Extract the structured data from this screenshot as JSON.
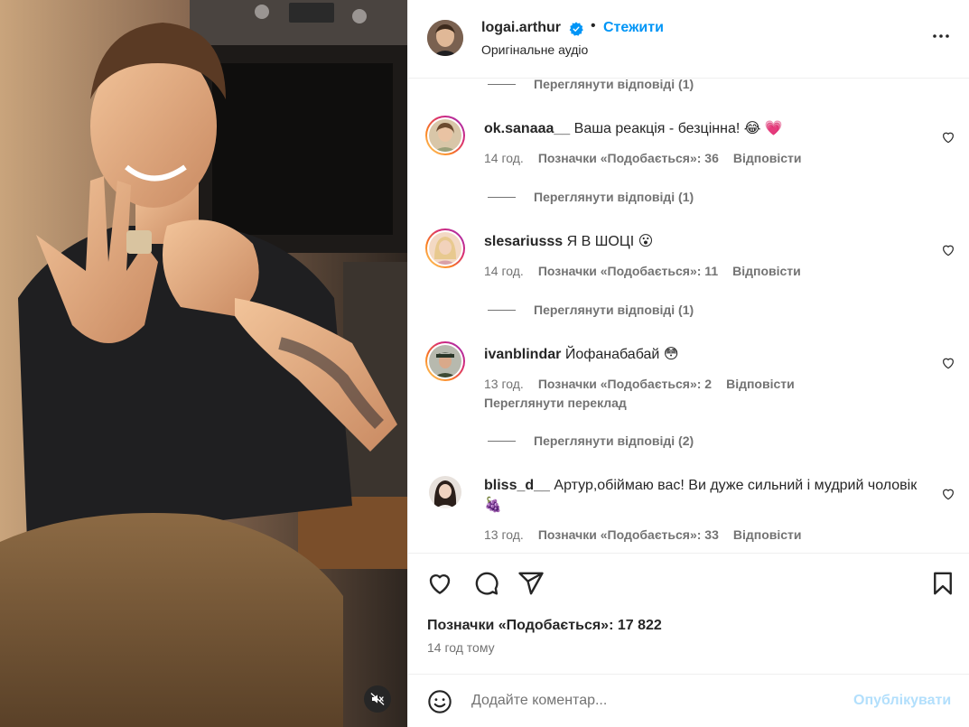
{
  "post": {
    "author": "logai.arthur",
    "follow_label": "Стежити",
    "separator": "•",
    "audio": "Оригінальне аудіо",
    "likes": "Позначки «Подобається»: 17 822",
    "time_ago": "14 год тому"
  },
  "comments": [
    {
      "top_replies": "Переглянути відповіді (1)"
    },
    {
      "user": "ok.sanaaa__",
      "text": "Ваша реакція - безцінна! 😂 💗",
      "time": "14 год.",
      "likes": "Позначки «Подобається»: 36",
      "reply": "Відповісти",
      "view_replies": "Переглянути відповіді (1)"
    },
    {
      "user": "slesariusss",
      "text": "Я В ШОЦІ 😮",
      "time": "14 год.",
      "likes": "Позначки «Подобається»: 11",
      "reply": "Відповісти",
      "view_replies": "Переглянути відповіді (1)"
    },
    {
      "user": "ivanblindar",
      "text": "Йофанабабай 😳",
      "time": "13 год.",
      "likes": "Позначки «Подобається»: 2",
      "reply": "Відповісти",
      "translate": "Переглянути переклад",
      "view_replies": "Переглянути відповіді (2)"
    },
    {
      "user": "bliss_d__",
      "text": "Артур,обіймаю вас! Ви дуже сильний і мудрий чоловік 🍇",
      "time": "13 год.",
      "likes": "Позначки «Подобається»: 33",
      "reply": "Відповісти"
    }
  ],
  "composer": {
    "placeholder": "Додайте коментар...",
    "publish_label": "Опублікувати"
  },
  "colors": {
    "accent": "#0095f6",
    "publish_disabled": "#b2dffc",
    "muted_text": "#737373"
  },
  "icons": [
    "verified-badge-icon",
    "more-options-icon",
    "heart-icon",
    "comment-icon",
    "share-icon",
    "bookmark-icon",
    "emoji-icon",
    "mute-icon"
  ]
}
